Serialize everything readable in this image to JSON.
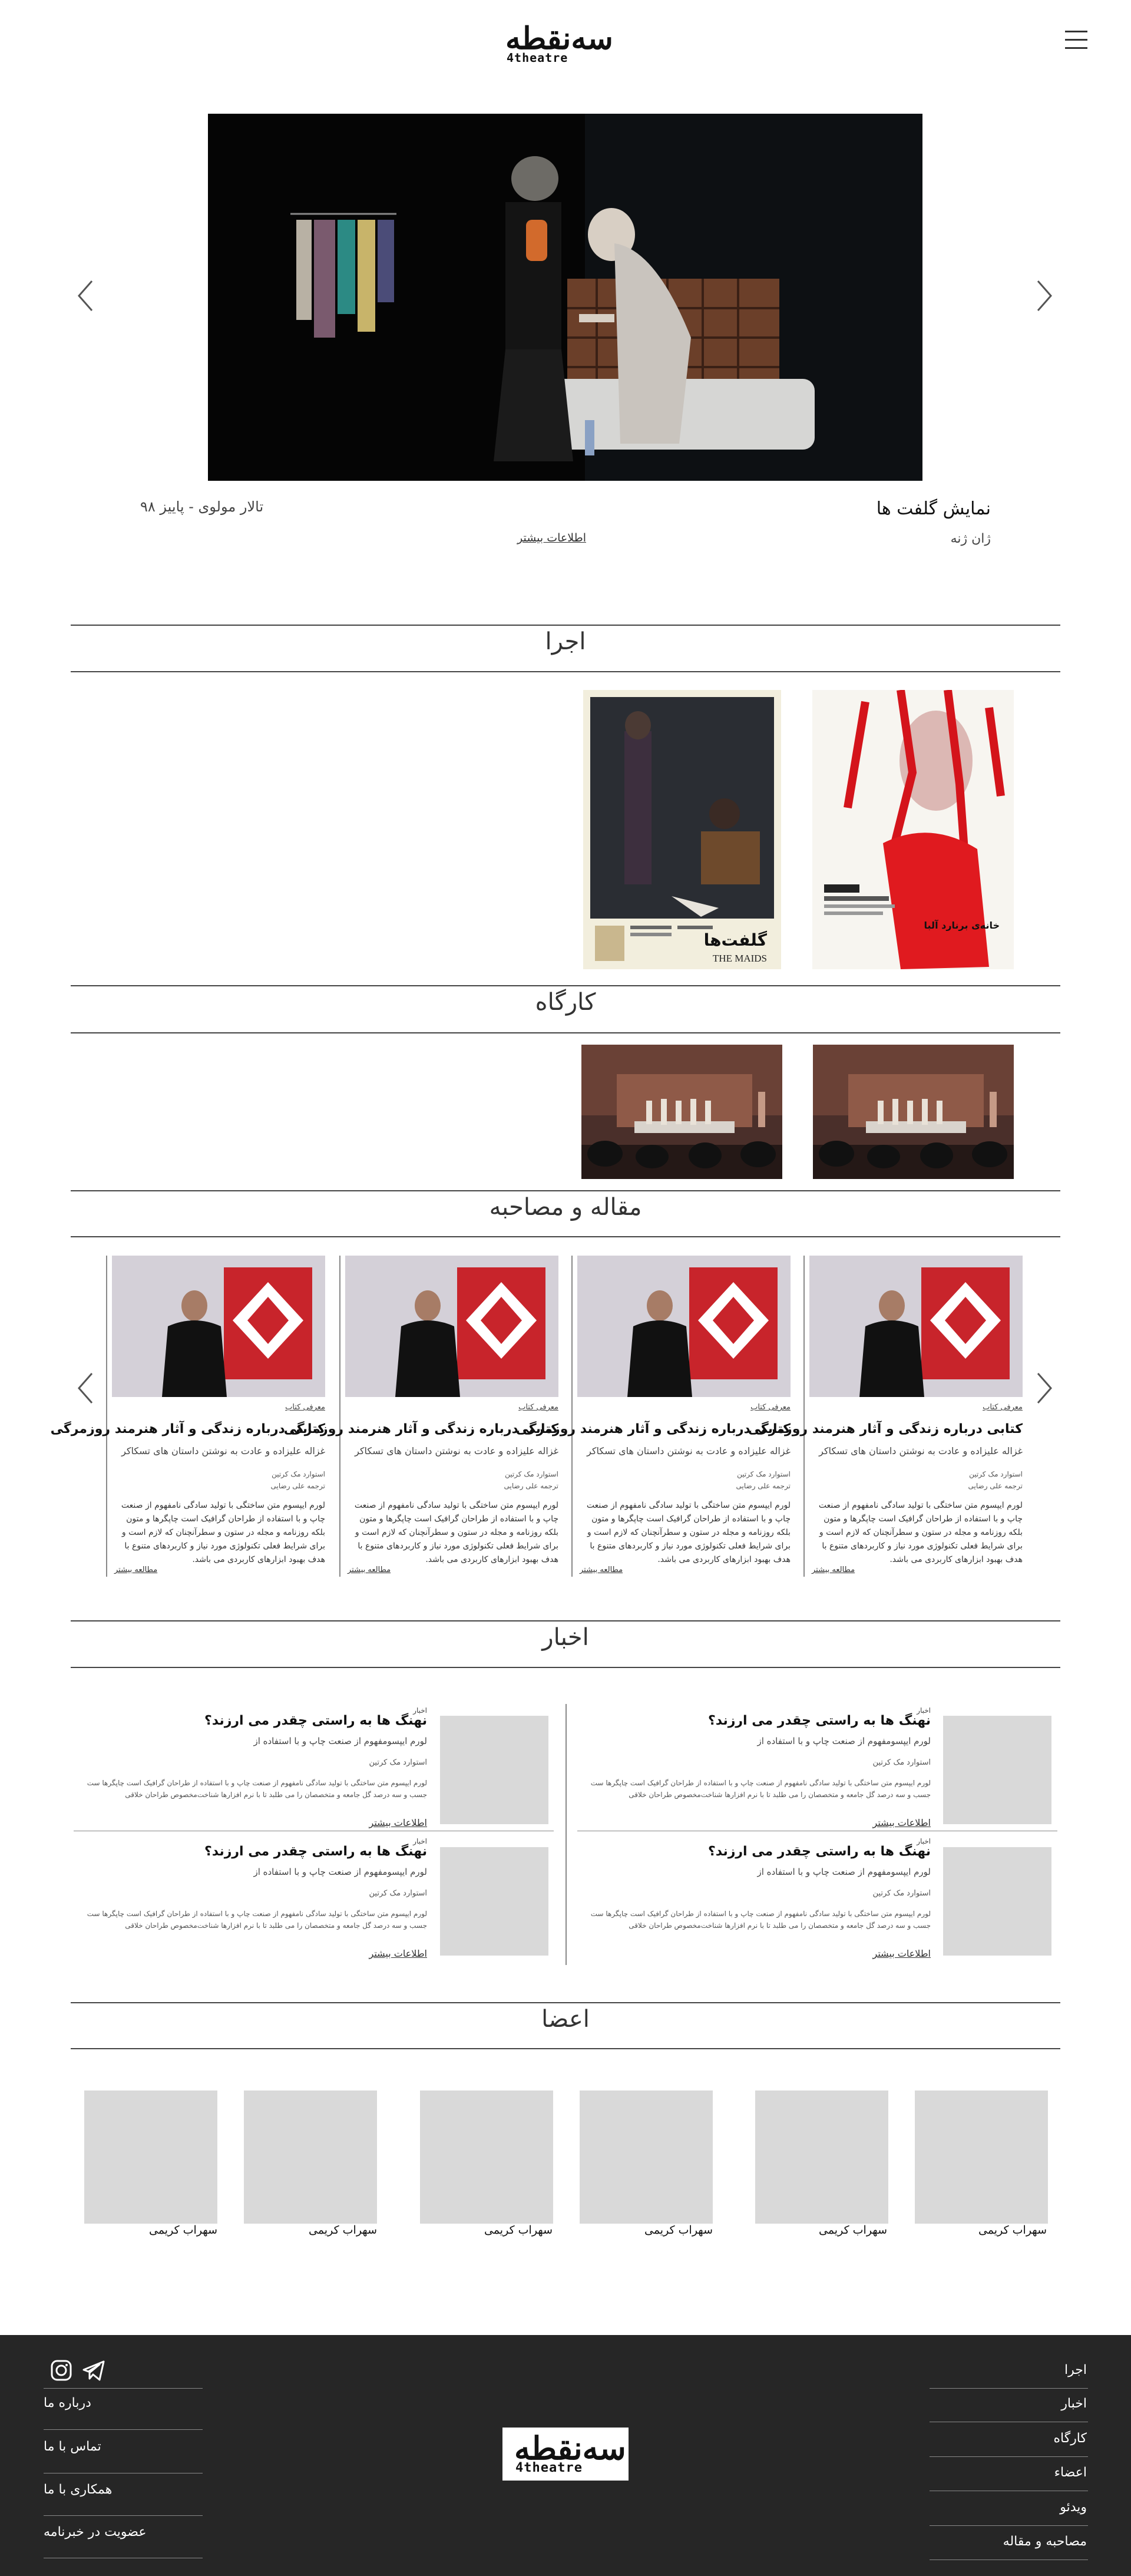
{
  "header": {
    "logo_mark": "سه‌نقطه",
    "logo_sub": "4theatre"
  },
  "hero": {
    "title": "نمایش گلفت ها",
    "person": "ژان ژنه",
    "venue": "تالار مولوی - پاییز ۹۸",
    "more": "اطلاعات بیشتر"
  },
  "sections": {
    "performance": "اجرا",
    "workshop": "کارگاه",
    "articles": "مقاله و مصاحبه",
    "news": "اخبار",
    "members": "اعضا"
  },
  "posters": {
    "maids_fa": "گلفت‌ها",
    "maids_en": "THE MAIDS",
    "blood_title": "خانه‌ی برنارد آلبا"
  },
  "articles": [
    {
      "tag": "معرفی کتاب",
      "title": "کتابی درباره زندگی و آثار هنرمند روزمرگی",
      "subtitle": "غزاله علیزاده و عادت به نوشتن داستان های تسکاکر",
      "meta1": "استوارد مک کرتین",
      "meta2": "ترجمه علی رضایی",
      "body": "لورم ایپسوم متن ساختگی با تولید سادگی نامفهوم از صنعت چاپ و با استفاده از طراحان گرافیک است چاپگرها و متون بلکه روزنامه و مجله در ستون و سطرآنچنان که لازم است و برای شرایط فعلی تکنولوژی مورد نیاز و کاربردهای متنوع با هدف بهبود ابزارهای کاربردی می باشد.",
      "more": "مطالعه بیشتر"
    },
    {
      "tag": "معرفی کتاب",
      "title": "کتابی درباره زندگی و آثار هنرمند روزمرگی",
      "subtitle": "غزاله علیزاده و عادت به نوشتن داستان های تسکاکر",
      "meta1": "استوارد مک کرتین",
      "meta2": "ترجمه علی رضایی",
      "body": "لورم ایپسوم متن ساختگی با تولید سادگی نامفهوم از صنعت چاپ و با استفاده از طراحان گرافیک است چاپگرها و متون بلکه روزنامه و مجله در ستون و سطرآنچنان که لازم است و برای شرایط فعلی تکنولوژی مورد نیاز و کاربردهای متنوع با هدف بهبود ابزارهای کاربردی می باشد.",
      "more": "مطالعه بیشتر"
    },
    {
      "tag": "معرفی کتاب",
      "title": "کتابی درباره زندگی و آثار هنرمند روزمرگی",
      "subtitle": "غزاله علیزاده و عادت به نوشتن داستان های تسکاکر",
      "meta1": "استوارد مک کرتین",
      "meta2": "ترجمه علی رضایی",
      "body": "لورم ایپسوم متن ساختگی با تولید سادگی نامفهوم از صنعت چاپ و با استفاده از طراحان گرافیک است چاپگرها و متون بلکه روزنامه و مجله در ستون و سطرآنچنان که لازم است و برای شرایط فعلی تکنولوژی مورد نیاز و کاربردهای متنوع با هدف بهبود ابزارهای کاربردی می باشد.",
      "more": "مطالعه بیشتر"
    },
    {
      "tag": "معرفی کتاب",
      "title": "کتابی درباره زندگی و آثار هنرمند روزمرگی",
      "subtitle": "غزاله علیزاده و عادت به نوشتن داستان های تسکاکر",
      "meta1": "استوارد مک کرتین",
      "meta2": "ترجمه علی رضایی",
      "body": "لورم ایپسوم متن ساختگی با تولید سادگی نامفهوم از صنعت چاپ و با استفاده از طراحان گرافیک است چاپگرها و متون بلکه روزنامه و مجله در ستون و سطرآنچنان که لازم است و برای شرایط فعلی تکنولوژی مورد نیاز و کاربردهای متنوع با هدف بهبود ابزارهای کاربردی می باشد.",
      "more": "مطالعه بیشتر"
    }
  ],
  "news": [
    {
      "cat": "اخبار",
      "title": "نهنگ ها به راستی چقدر می ارزند؟",
      "sub": "لورم ایپسومفهوم از صنعت چاپ و با استفاده از",
      "author": "استوارد مک کرتین",
      "body": "لورم ایپسوم متن ساختگی با تولید سادگی نامفهوم از صنعت چاپ و با استفاده از طراحان گرافیک است چاپگرها ست جسب و سه درصد گل جامعه و متخصصان را می طلبد تا با نرم افزارها شناخت‌مخصوص طراحان خلاقی",
      "more": "اطلاعات بیشتر"
    },
    {
      "cat": "اخبار",
      "title": "نهنگ ها به راستی چقدر می ارزند؟",
      "sub": "لورم ایپسومفهوم از صنعت چاپ و با استفاده از",
      "author": "استوارد مک کرتین",
      "body": "لورم ایپسوم متن ساختگی با تولید سادگی نامفهوم از صنعت چاپ و با استفاده از طراحان گرافیک است چاپگرها ست جسب و سه درصد گل جامعه و متخصصان را می طلبد تا با نرم افزارها شناخت‌مخصوص طراحان خلاقی",
      "more": "اطلاعات بیشتر"
    },
    {
      "cat": "اخبار",
      "title": "نهنگ ها به راستی چقدر می ارزند؟",
      "sub": "لورم ایپسومفهوم از صنعت چاپ و با استفاده از",
      "author": "استوارد مک کرتین",
      "body": "لورم ایپسوم متن ساختگی با تولید سادگی نامفهوم از صنعت چاپ و با استفاده از طراحان گرافیک است چاپگرها ست جسب و سه درصد گل جامعه و متخصصان را می طلبد تا با نرم افزارها شناخت‌مخصوص طراحان خلاقی",
      "more": "اطلاعات بیشتر"
    },
    {
      "cat": "اخبار",
      "title": "نهنگ ها به راستی چقدر می ارزند؟",
      "sub": "لورم ایپسومفهوم از صنعت چاپ و با استفاده از",
      "author": "استوارد مک کرتین",
      "body": "لورم ایپسوم متن ساختگی با تولید سادگی نامفهوم از صنعت چاپ و با استفاده از طراحان گرافیک است چاپگرها ست جسب و سه درصد گل جامعه و متخصصان را می طلبد تا با نرم افزارها شناخت‌مخصوص طراحان خلاقی",
      "more": "اطلاعات بیشتر"
    }
  ],
  "members": [
    "سهراب کریمی",
    "سهراب کریمی",
    "سهراب کریمی",
    "سهراب کریمی",
    "سهراب کریمی",
    "سهراب کریمی"
  ],
  "footer": {
    "right_links": [
      "اجرا",
      "اخبار",
      "کارگاه",
      "اعضاء",
      "ویدئو",
      "مصاحبه و مقاله"
    ],
    "left_links": [
      "درباره ما",
      "تماس با ما",
      "همکاری با ما",
      "عضویت در خبرنامه"
    ],
    "icons": [
      "instagram-icon",
      "telegram-icon"
    ]
  },
  "colors": {
    "footer_bg": "#262626",
    "placeholder": "#d9d9d9",
    "accent_red": "#c8242b"
  }
}
